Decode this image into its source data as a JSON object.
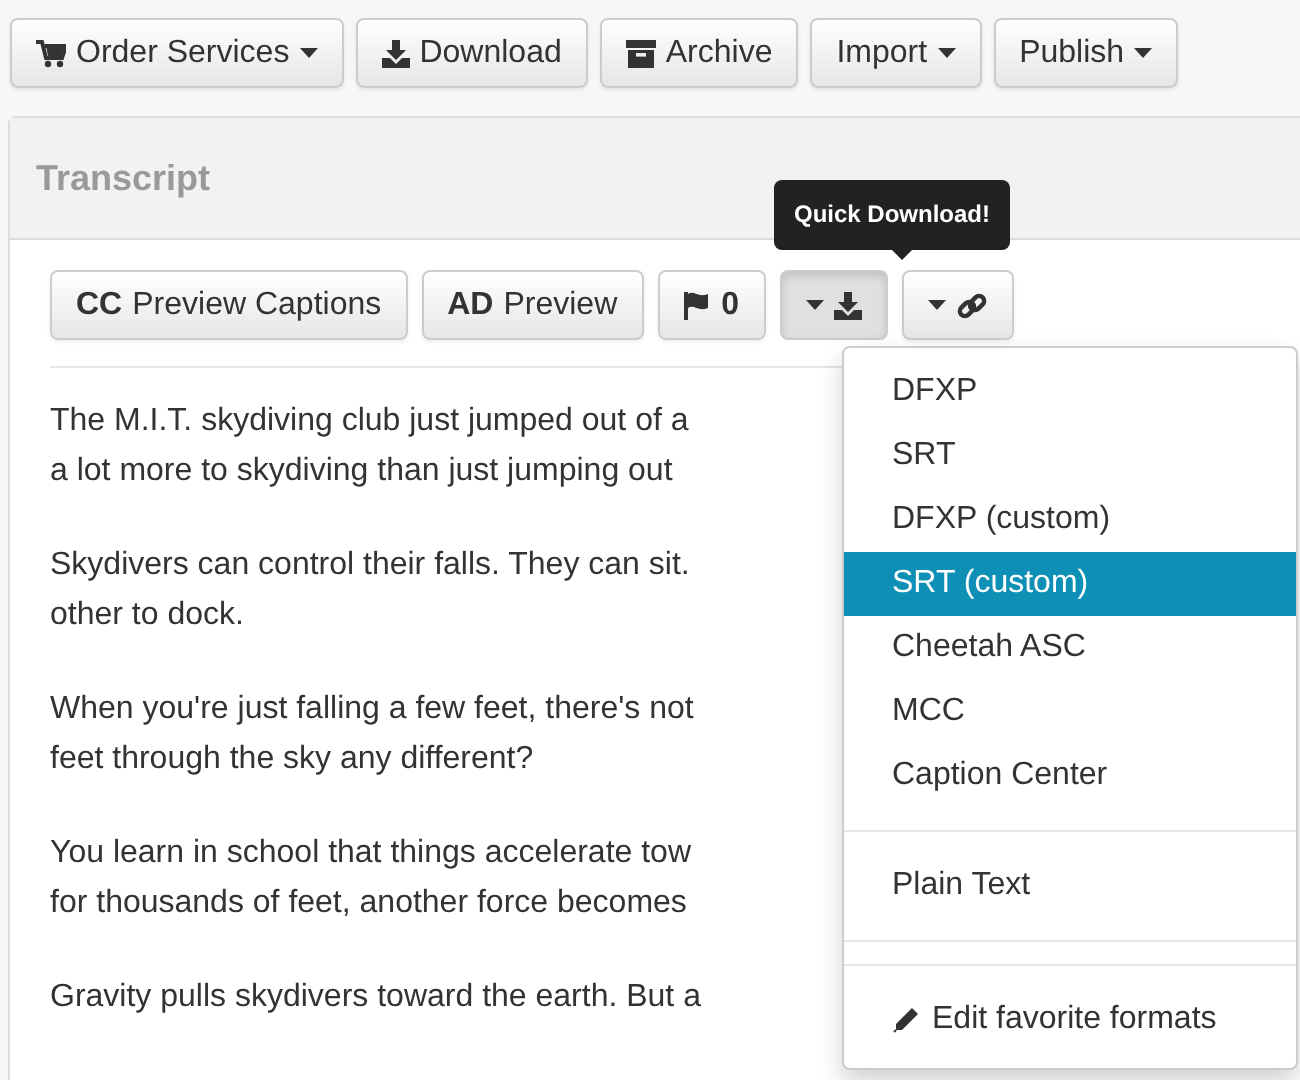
{
  "toolbar": [
    {
      "label": "Order Services",
      "kind": "cart",
      "dropdown": true
    },
    {
      "label": "Download",
      "kind": "download",
      "dropdown": false
    },
    {
      "label": "Archive",
      "kind": "archive",
      "dropdown": false
    },
    {
      "label": "Import",
      "kind": "none",
      "dropdown": true
    },
    {
      "label": "Publish",
      "kind": "none",
      "dropdown": true
    }
  ],
  "panel": {
    "title": "Transcript",
    "tooltip": "Quick Download!",
    "buttons": [
      {
        "kind": "text",
        "label": "**CC** Preview Captions",
        "active": false
      },
      {
        "kind": "text",
        "label": "**AD** Preview",
        "active": false
      },
      {
        "kind": "flag",
        "label": "0",
        "active": false
      },
      {
        "kind": "download",
        "active": true
      },
      {
        "kind": "link",
        "active": false
      }
    ],
    "paragraphs": [
      {
        "lines": [
          "The M.I.T. skydiving club just jumped out of a",
          "a lot more to skydiving than just jumping out"
        ]
      },
      {
        "lines": [
          "Skydivers can control their falls. They can sit.",
          "other to dock."
        ]
      },
      {
        "lines": [
          "When you're just falling a few feet, there's not",
          "feet through the sky any different?"
        ]
      },
      {
        "lines": [
          "You learn in school that things accelerate tow",
          "for thousands of feet, another force becomes"
        ]
      },
      {
        "lines": [
          "Gravity pulls skydivers toward the earth. But a"
        ]
      }
    ],
    "menu": [
      {
        "kind": "item",
        "label": "DFXP",
        "selected": false
      },
      {
        "kind": "item",
        "label": "SRT",
        "selected": false
      },
      {
        "kind": "item",
        "label": "DFXP (custom)",
        "selected": false
      },
      {
        "kind": "item",
        "label": "SRT (custom)",
        "selected": true
      },
      {
        "kind": "item",
        "label": "Cheetah ASC",
        "selected": false
      },
      {
        "kind": "item",
        "label": "MCC",
        "selected": false
      },
      {
        "kind": "item",
        "label": "Caption Center",
        "selected": false
      },
      {
        "kind": "divider"
      },
      {
        "kind": "item",
        "label": "Plain Text",
        "selected": false
      },
      {
        "kind": "divider"
      },
      {
        "kind": "divider"
      },
      {
        "kind": "edit",
        "label": "Edit favorite formats",
        "selected": false
      }
    ]
  }
}
